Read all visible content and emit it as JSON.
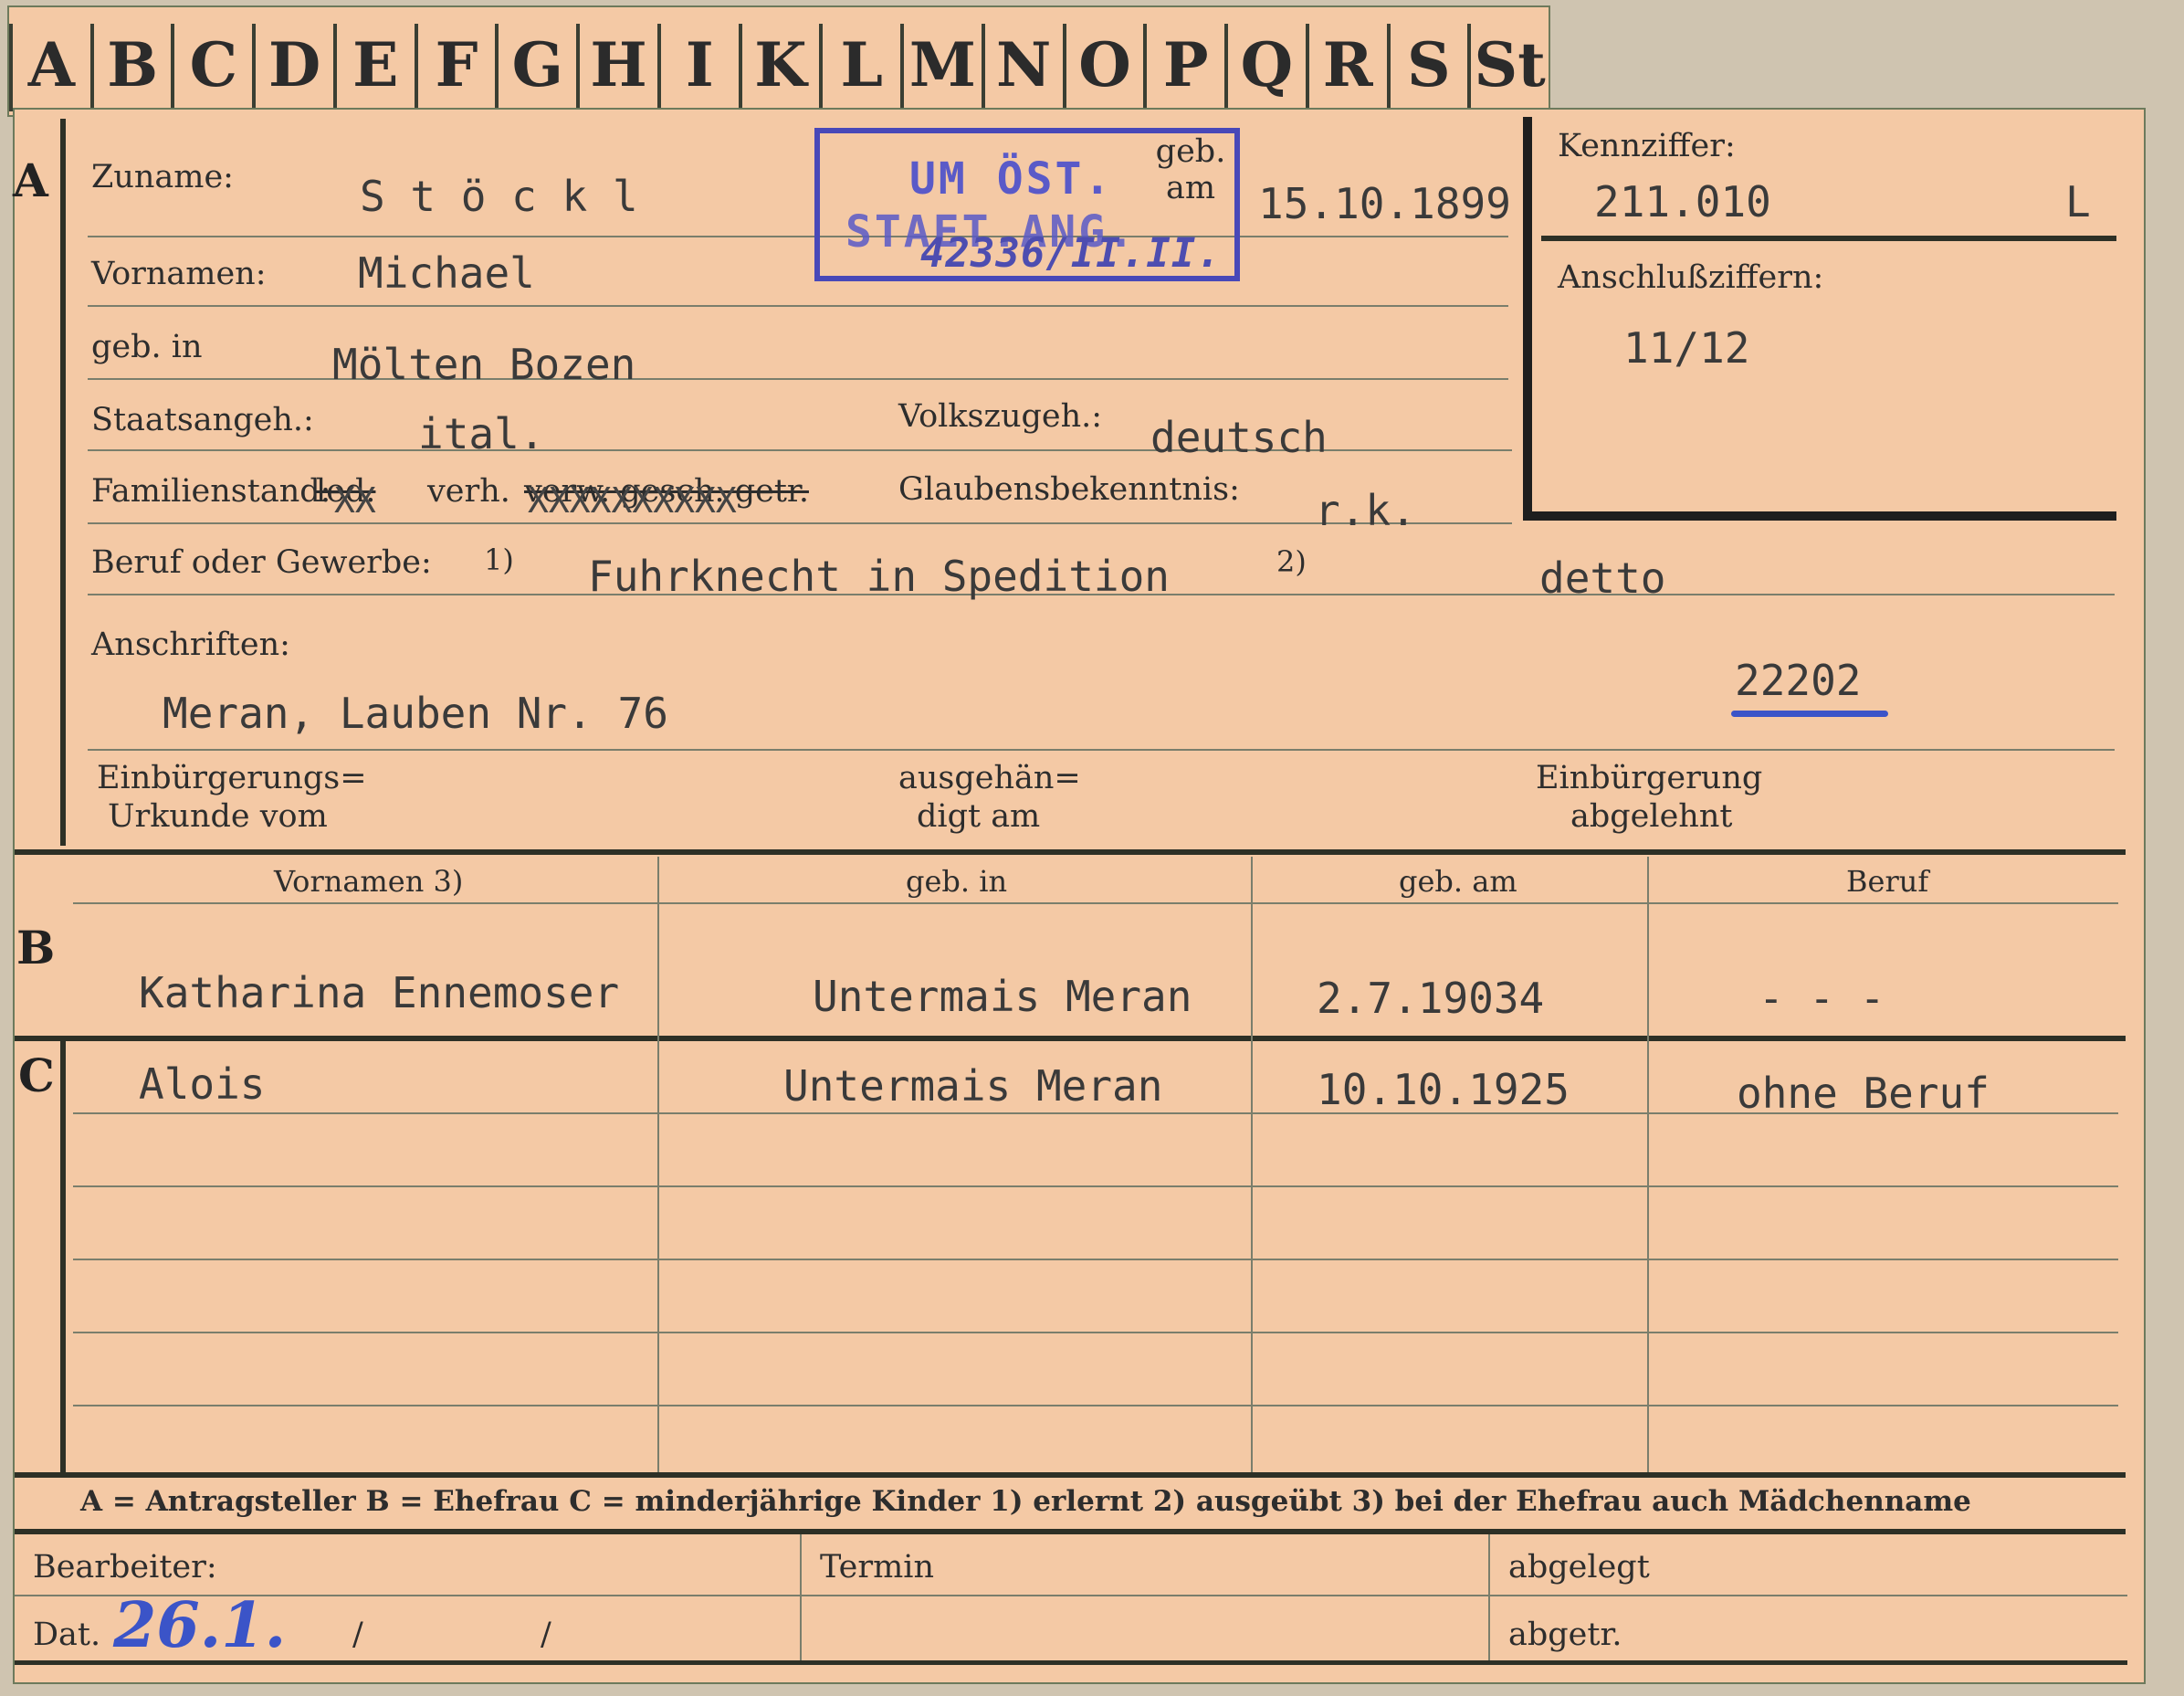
{
  "tabs": [
    "A",
    "B",
    "C",
    "D",
    "E",
    "F",
    "G",
    "H",
    "I",
    "K",
    "L",
    "M",
    "N",
    "O",
    "P",
    "Q",
    "R",
    "S",
    "St"
  ],
  "section_labels": {
    "a": "A",
    "b": "B",
    "c": "C"
  },
  "labels": {
    "zuname": "Zuname:",
    "vornamen": "Vornamen:",
    "geb_in": "geb. in",
    "geb_am": "geb. am",
    "staatsangeh": "Staatsangeh.:",
    "volkszugeh": "Volkszugeh.:",
    "familienstand_prefix": "Familienstand:",
    "familienstand_led": "led.",
    "familienstand_verh": "verh.",
    "familienstand_rest": "verw. gesch. getr.",
    "glaubensbekenntnis": "Glaubensbekenntnis:",
    "beruf": "Beruf oder Gewerbe:",
    "fn1": "1)",
    "fn2": "2)",
    "anschriften": "Anschriften:",
    "einbuergerung_l1": "Einbürgerungs=",
    "einbuergerung_l2": "Urkunde vom",
    "ausgehaendigt_l1": "ausgehän=",
    "ausgehaendigt_l2": "digt am",
    "abgelehnt_l1": "Einbürgerung",
    "abgelehnt_l2": "abgelehnt",
    "kennziffer": "Kennziffer:",
    "anschlussziffern": "Anschlußziffern:"
  },
  "values": {
    "zuname": "S t ö c k l",
    "vornamen": "Michael",
    "geb_am": "15.10.1899",
    "geb_in": "Mölten Bozen",
    "staatsangeh": "ital.",
    "volkszugeh": "deutsch",
    "familienstand_x1": "XX",
    "familienstand_x2": "XXXXXXXXXX",
    "glaubensbekenntnis": "r.k.",
    "beruf_erlernt": "Fuhrknecht in Spedition",
    "beruf_ausgeuebt": "detto",
    "anschrift": "Meran, Lauben Nr. 76",
    "anschrift_nr": "22202",
    "kennziffer": "211.010",
    "kennziffer_suffix": "L",
    "anschlussziffern": "11/12"
  },
  "stamp": {
    "line1": "UM ÖST.",
    "line2": "STAET.ANG.",
    "handwritten": "42336/II.II."
  },
  "table_headers": [
    "Vornamen 3)",
    "geb. in",
    "geb. am",
    "Beruf"
  ],
  "ehefrau": {
    "vornamen": "Katharina Ennemoser",
    "geb_in": "Untermais Meran",
    "geb_am": "2.7.19034",
    "beruf": "- - -"
  },
  "kinder": [
    {
      "vornamen": "Alois",
      "geb_in": "Untermais Meran",
      "geb_am": "10.10.1925",
      "beruf": "ohne Beruf"
    }
  ],
  "legend": "A = Antragsteller   B = Ehefrau   C = minderjährige Kinder   1) erlernt   2) ausgeübt   3) bei der Ehefrau auch Mädchenname",
  "footer": {
    "bearbeiter": "Bearbeiter:",
    "dat": "Dat.",
    "dat_value": "26.1.",
    "slash1": "/",
    "slash2": "/",
    "termin": "Termin",
    "abgelegt": "abgelegt",
    "abgetr": "abgetr."
  },
  "colors": {
    "card": "#f4c9a5",
    "stamp_blue": "#4848b8",
    "ink_blue": "#3b54c8",
    "rule": "#2d3026"
  }
}
